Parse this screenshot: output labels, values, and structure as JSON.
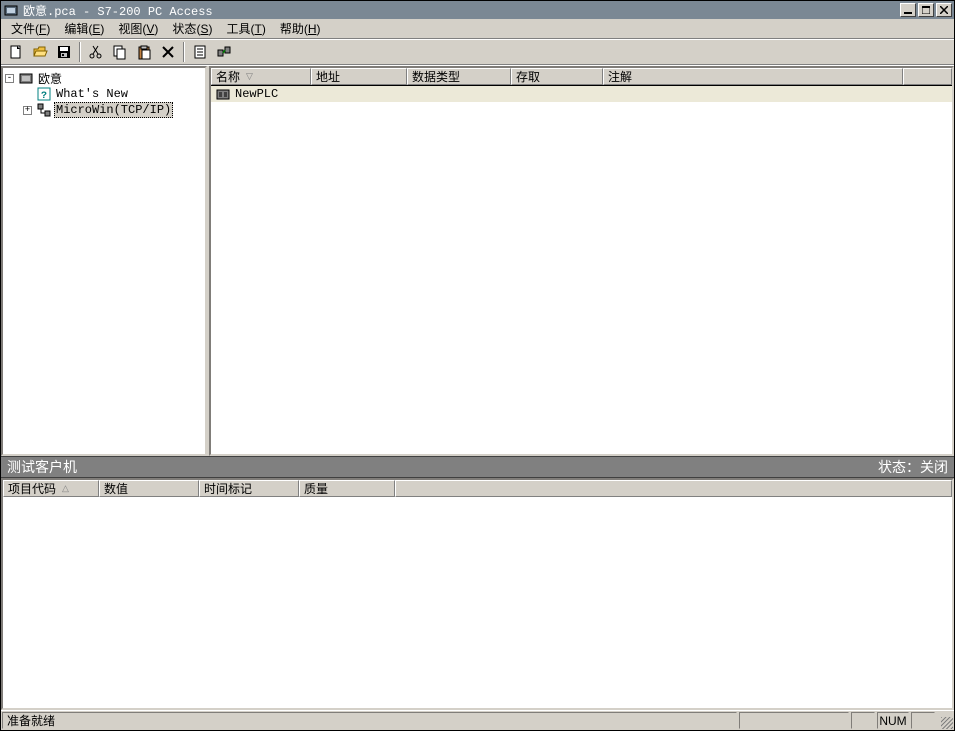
{
  "titlebar": {
    "text": "欧意.pca - S7-200 PC Access"
  },
  "menu": {
    "file": {
      "label": "文件",
      "key": "F"
    },
    "edit": {
      "label": "编辑",
      "key": "E"
    },
    "view": {
      "label": "视图",
      "key": "V"
    },
    "status": {
      "label": "状态",
      "key": "S"
    },
    "tools": {
      "label": "工具",
      "key": "T"
    },
    "help": {
      "label": "帮助",
      "key": "H"
    }
  },
  "toolbar": {
    "icons": {
      "new": "new",
      "open": "open",
      "save": "save",
      "cut": "cut",
      "copy": "copy",
      "paste": "paste",
      "delete": "delete",
      "props": "props",
      "connect": "connect"
    }
  },
  "tree": {
    "root": {
      "label": "欧意"
    },
    "whatsnew": {
      "label": "What's New"
    },
    "microwin": {
      "label": "MicroWin(TCP/IP)"
    }
  },
  "list": {
    "headers": {
      "name": "名称",
      "address": "地址",
      "datatype": "数据类型",
      "access": "存取",
      "comment": "注解"
    },
    "rows": [
      {
        "name": "NewPLC"
      }
    ]
  },
  "testclient": {
    "title": "测试客户机",
    "status_label": "状态：",
    "status_value": "关闭",
    "headers": {
      "itemid": "项目代码",
      "value": "数值",
      "timestamp": "时间标记",
      "quality": "质量"
    }
  },
  "statusbar": {
    "ready": "准备就绪",
    "num": "NUM"
  }
}
